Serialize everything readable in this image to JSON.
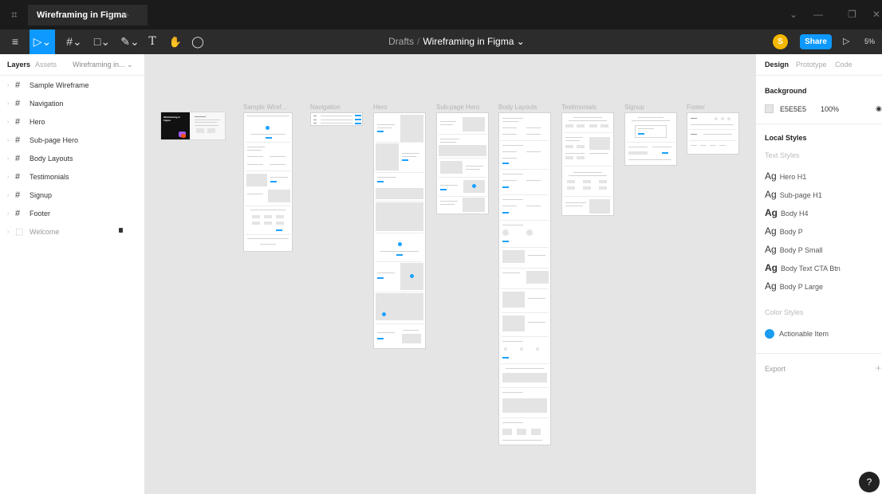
{
  "titlebar": {
    "tab_title": "Wireframing in Figma",
    "tab_close": "×",
    "tab_add": "+",
    "window_buttons": [
      "⌄",
      "—",
      "❐",
      "✕"
    ]
  },
  "toolbar": {
    "menu_icon": "≡",
    "move_tool": "▷⌄",
    "frame_tool": "#⌄",
    "shape_tool": "□⌄",
    "pen_tool": "✎⌄",
    "text_tool": "T",
    "hand_tool": "✋",
    "comment_tool": "◯",
    "breadcrumb_parent": "Drafts",
    "breadcrumb_sep": "/",
    "breadcrumb_current": "Wireframing in Figma ⌄",
    "avatar_initial": "S",
    "share_label": "Share",
    "play_icon": "▷",
    "zoom": "5% ⌄"
  },
  "left_panel": {
    "tabs": [
      "Layers",
      "Assets",
      "Wireframing in... ⌄"
    ],
    "layers": [
      {
        "label": "Sample Wireframe",
        "icon": "#"
      },
      {
        "label": "Navigation",
        "icon": "#"
      },
      {
        "label": "Hero",
        "icon": "#"
      },
      {
        "label": "Sub-page Hero",
        "icon": "#"
      },
      {
        "label": "Body Layouts",
        "icon": "#"
      },
      {
        "label": "Testimonials",
        "icon": "#"
      },
      {
        "label": "Signup",
        "icon": "#"
      },
      {
        "label": "Footer",
        "icon": "#"
      },
      {
        "label": "Welcome",
        "icon": "⬚"
      }
    ]
  },
  "canvas": {
    "background": "#E5E5E5",
    "frame_labels": [
      "Sample Wiref...",
      "Navigation",
      "Hero",
      "Sub-page Hero",
      "Body Layouts",
      "Testimonials",
      "Signup",
      "Footer"
    ],
    "welcome_text": "Wireframing in Figma"
  },
  "right_panel": {
    "tabs": [
      "Design",
      "Prototype",
      "Code"
    ],
    "background_title": "Background",
    "background_hex": "E5E5E5",
    "background_opacity": "100%",
    "eye_icon": "👁",
    "local_styles_title": "Local Styles",
    "text_styles_title": "Text Styles",
    "text_styles": [
      {
        "ag": "Ag",
        "name": "Hero H1"
      },
      {
        "ag": "Ag",
        "name": "Sub-page H1"
      },
      {
        "ag": "Ag",
        "name": "Body H4"
      },
      {
        "ag": "Ag",
        "name": "Body P"
      },
      {
        "ag": "Ag",
        "name": "Body P Small"
      },
      {
        "ag": "Ag",
        "name": "Body Text CTA Btn"
      },
      {
        "ag": "Ag",
        "name": "Body P Large"
      }
    ],
    "color_styles_title": "Color Styles",
    "color_style_name": "Actionable Item",
    "color_style_color": "#1A9CF0",
    "export_title": "Export",
    "export_add": "+"
  },
  "help": "?"
}
